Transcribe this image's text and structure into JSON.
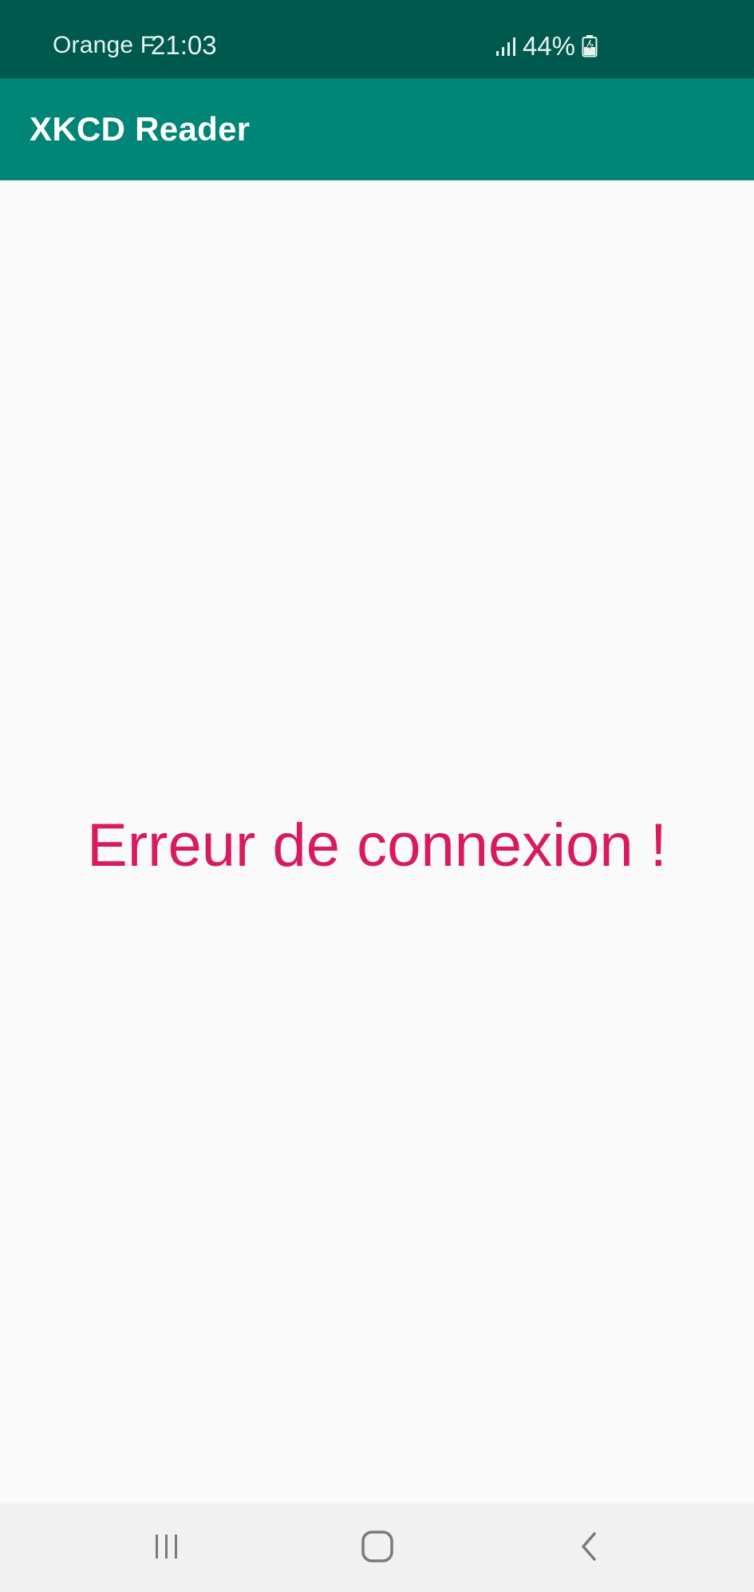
{
  "status_bar": {
    "carrier": "Orange F",
    "time": "21:03",
    "battery_percent": "44%",
    "signal_icon": "signal-bars-icon",
    "battery_icon": "battery-charging-icon"
  },
  "app_bar": {
    "title": "XKCD Reader"
  },
  "main": {
    "error_message": "Erreur de connexion !"
  },
  "nav_bar": {
    "recents_icon": "recents-icon",
    "home_icon": "home-icon",
    "back_icon": "back-icon"
  },
  "colors": {
    "status_bar": "#00594d",
    "app_bar": "#008577",
    "error_text": "#d81b60",
    "background": "#fafafa",
    "nav_bar": "#f1f1f1"
  }
}
